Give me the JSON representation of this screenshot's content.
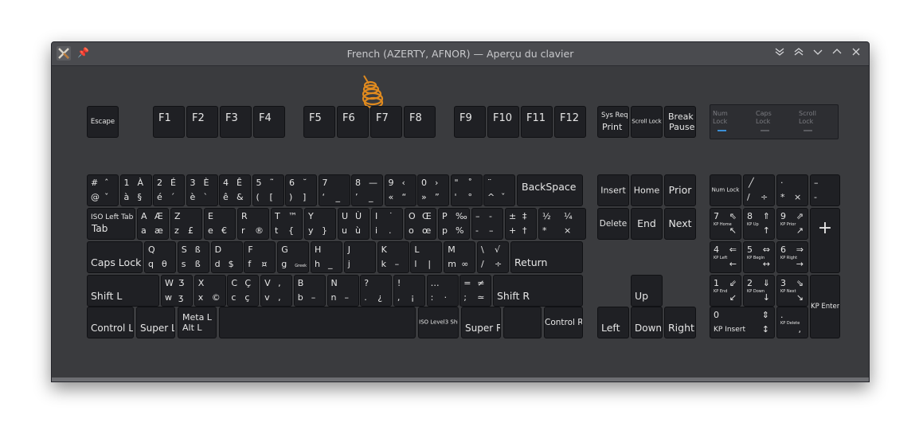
{
  "window": {
    "title": "French (AZERTY, AFNOR) — Aperçu du clavier",
    "app_icon": "kde-x-icon",
    "controls": [
      "keep-below-icon",
      "keep-above-icon",
      "minimize-icon",
      "maximize-icon",
      "close-icon"
    ]
  },
  "colors": {
    "window_bg": "#3a3b3e",
    "key_bg": "#1f2024",
    "key_text": "#e6e6e6",
    "led_on": "#3b8fd6"
  },
  "function_row": {
    "escape": "Escape",
    "fkeys": [
      "F1",
      "F2",
      "F3",
      "F4",
      "F5",
      "F6",
      "F7",
      "F8",
      "F9",
      "F10",
      "F11",
      "F12"
    ],
    "print": {
      "top": "Sys Req",
      "bottom": "Print"
    },
    "scroll_lock": "Scroll Lock",
    "pause": {
      "top": "Break",
      "bottom": "Pause"
    }
  },
  "lock_indicators": [
    {
      "line1": "Num",
      "line2": "Lock"
    },
    {
      "line1": "Caps",
      "line2": "Lock"
    },
    {
      "line1": "Scroll",
      "line2": "Lock"
    }
  ],
  "keys": {
    "r1": [
      {
        "tl": "#",
        "tr": "ˆ",
        "bl": "@",
        "br": "ˇ"
      },
      {
        "tl": "1",
        "tr": "À",
        "bl": "à",
        "br": "§"
      },
      {
        "tl": "2",
        "tr": "É",
        "bl": "é",
        "br": "´"
      },
      {
        "tl": "3",
        "tr": "È",
        "bl": "è",
        "br": "`"
      },
      {
        "tl": "4",
        "tr": "Ê",
        "bl": "ê",
        "br": "&"
      },
      {
        "tl": "5",
        "tr": "˜",
        "bl": "(",
        "br": "["
      },
      {
        "tl": "6",
        "tr": "˘",
        "bl": ")",
        "br": "]"
      },
      {
        "tl": "7",
        "tr": "",
        "bl": "‘",
        "br": "_"
      },
      {
        "tl": "8",
        "tr": "—",
        "bl": "’",
        "br": "_"
      },
      {
        "tl": "9",
        "tr": "‹",
        "bl": "«",
        "br": "“"
      },
      {
        "tl": "0",
        "tr": "›",
        "bl": "»",
        "br": "”"
      },
      {
        "tl": "\"",
        "tr": "˚",
        "bl": "'",
        "br": "°"
      },
      {
        "tl": "¨",
        "tr": "",
        "bl": "^",
        "br": "ˇ"
      }
    ],
    "backspace": "BackSpace",
    "tab": {
      "top": "ISO Left Tab",
      "bottom": "Tab"
    },
    "r2": [
      {
        "tl": "A",
        "tr": "Æ",
        "bl": "a",
        "br": "æ"
      },
      {
        "tl": "Z",
        "tr": "",
        "bl": "z",
        "br": "£"
      },
      {
        "tl": "E",
        "tr": "",
        "bl": "e",
        "br": "€"
      },
      {
        "tl": "R",
        "tr": "",
        "bl": "r",
        "br": "®"
      },
      {
        "tl": "T",
        "tr": "™",
        "bl": "t",
        "br": "{"
      },
      {
        "tl": "Y",
        "tr": "",
        "bl": "y",
        "br": "}"
      },
      {
        "tl": "U",
        "tr": "Ù",
        "bl": "u",
        "br": "ù"
      },
      {
        "tl": "I",
        "tr": "˙",
        "bl": "i",
        "br": "."
      },
      {
        "tl": "O",
        "tr": "Œ",
        "bl": "o",
        "br": "œ"
      },
      {
        "tl": "P",
        "tr": "‰",
        "bl": "p",
        "br": "%"
      },
      {
        "tl": "–",
        "tr": "-",
        "bl": "-",
        "br": "–"
      },
      {
        "tl": "±",
        "tr": "‡",
        "bl": "+",
        "br": "†"
      },
      {
        "tl": "½",
        "tr": "¼",
        "bl": "*",
        "br": "×"
      }
    ],
    "caps": "Caps Lock",
    "r3": [
      {
        "tl": "Q",
        "tr": "",
        "bl": "q",
        "br": "θ"
      },
      {
        "tl": "S",
        "tr": "ß",
        "bl": "s",
        "br": "ß"
      },
      {
        "tl": "D",
        "tr": "",
        "bl": "d",
        "br": "$"
      },
      {
        "tl": "F",
        "tr": "",
        "bl": "f",
        "br": "¤"
      },
      {
        "tl": "G",
        "tr": "",
        "bl": "g",
        "br": "Greek"
      },
      {
        "tl": "H",
        "tr": "",
        "bl": "h",
        "br": "_"
      },
      {
        "tl": "J",
        "tr": "",
        "bl": "j",
        "br": ""
      },
      {
        "tl": "K",
        "tr": "",
        "bl": "k",
        "br": "–"
      },
      {
        "tl": "L",
        "tr": "",
        "bl": "l",
        "br": "|"
      },
      {
        "tl": "M",
        "tr": "",
        "bl": "m",
        "br": "∞"
      },
      {
        "tl": "\\",
        "tr": "√",
        "bl": "/",
        "br": "÷"
      }
    ],
    "return": "Return",
    "shift_l": "Shift L",
    "r4": [
      {
        "tl": "W",
        "tr": "Ʒ",
        "bl": "w",
        "br": "ʒ"
      },
      {
        "tl": "X",
        "tr": "",
        "bl": "x",
        "br": "©"
      },
      {
        "tl": "C",
        "tr": "Ç",
        "bl": "c",
        "br": "ç"
      },
      {
        "tl": "V",
        "tr": ",",
        "bl": "v",
        "br": ","
      },
      {
        "tl": "B",
        "tr": "",
        "bl": "b",
        "br": "–"
      },
      {
        "tl": "N",
        "tr": "",
        "bl": "n",
        "br": "–"
      },
      {
        "tl": "?",
        "tr": "",
        "bl": ".",
        "br": "¿"
      },
      {
        "tl": "!",
        "tr": "",
        "bl": ",",
        "br": "¡"
      },
      {
        "tl": "…",
        "tr": "",
        "bl": ":",
        "br": "·"
      },
      {
        "tl": "=",
        "tr": "≠",
        "bl": ";",
        "br": "≃"
      }
    ],
    "shift_r": "Shift R",
    "control_l": "Control L",
    "super_l": "Super L",
    "alt_l": {
      "top": "Meta L",
      "bottom": "Alt L"
    },
    "level3": "ISO Level3 Shift",
    "super_r": "Super R",
    "control_r": "Control R"
  },
  "nav": {
    "insert": "Insert",
    "home": "Home",
    "prior": "Prior",
    "delete": "Delete",
    "end": "End",
    "next": "Next",
    "up": "Up",
    "left": "Left",
    "down": "Down",
    "right": "Right"
  },
  "numpad": {
    "numlock": "Num Lock",
    "divide": {
      "tr": "╱",
      "bl": "/",
      "br": "÷"
    },
    "multiply": {
      "tl": "·",
      "bl": "*",
      "br": "×"
    },
    "minus": {
      "tl": "–",
      "bl": "-"
    },
    "plus": "+",
    "kp7": {
      "tl": "7",
      "tr": "⇖",
      "bl": "KP Home",
      "br": "↖"
    },
    "kp8": {
      "tl": "8",
      "tr": "⇑",
      "bl": "KP Up",
      "br": "↑"
    },
    "kp9": {
      "tl": "9",
      "tr": "⇗",
      "bl": "KP Prior",
      "br": "↗"
    },
    "kp4": {
      "tl": "4",
      "tr": "⇐",
      "bl": "KP Left",
      "br": "←"
    },
    "kp5": {
      "tl": "5",
      "tr": "⇔",
      "bl": "KP Begin",
      "br": "↔"
    },
    "kp6": {
      "tl": "6",
      "tr": "⇒",
      "bl": "KP Right",
      "br": "→"
    },
    "kp1": {
      "tl": "1",
      "tr": "⇙",
      "bl": "KP End",
      "br": "↙"
    },
    "kp2": {
      "tl": "2",
      "tr": "⇓",
      "bl": "KP Down",
      "br": "↓"
    },
    "kp3": {
      "tl": "3",
      "tr": "⇘",
      "bl": "KP Next",
      "br": "↘"
    },
    "kp0": {
      "tl": "0",
      "tr": "⇕",
      "bl": "KP Insert",
      "br": "↕"
    },
    "kpdec": {
      "tl": ".",
      "bl": "KP Delete",
      "br": ","
    },
    "enter": "KP Enter"
  }
}
